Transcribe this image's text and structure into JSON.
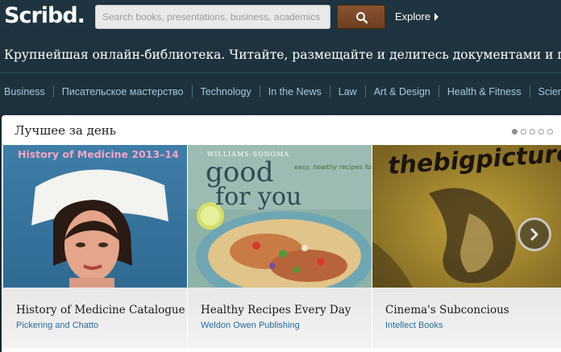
{
  "header": {
    "logo_text": "Scribd.",
    "search_placeholder": "Search books, presentations, business, academics",
    "search_icon": "search-icon",
    "explore_label": "Explore"
  },
  "tagline": "Крупнейшая онлайн-библиотека. Читайте, размещайте и делитесь документами и пис",
  "categories": [
    "Business",
    "Писательское мастерство",
    "Technology",
    "In the News",
    "Law",
    "Art & Design",
    "Health & Fitness",
    "Science"
  ],
  "featured": {
    "title": "Лучшее за день",
    "pagination_dots": 5,
    "active_dot": 1,
    "cards": [
      {
        "title": "History of Medicine Catalogue",
        "author": "Pickering and Chatto",
        "cover_heading": "History of Medicine 2013–14"
      },
      {
        "title": "Healthy Recipes Every Day",
        "author": "Weldon Owen Publishing",
        "cover_brand": "WILLIAMS-SONOMA",
        "cover_line1": "good",
        "cover_line2": "for you",
        "cover_tag": "easy, healthy recipes for every day"
      },
      {
        "title": "Cinema's Subconcious",
        "author": "Intellect Books",
        "cover_heading": "thebigpicture"
      }
    ]
  },
  "colors": {
    "background": "#1c2f3a",
    "nav_link": "#a9c7db",
    "search_button": "#7a4826",
    "author_link": "#2a6da0"
  }
}
